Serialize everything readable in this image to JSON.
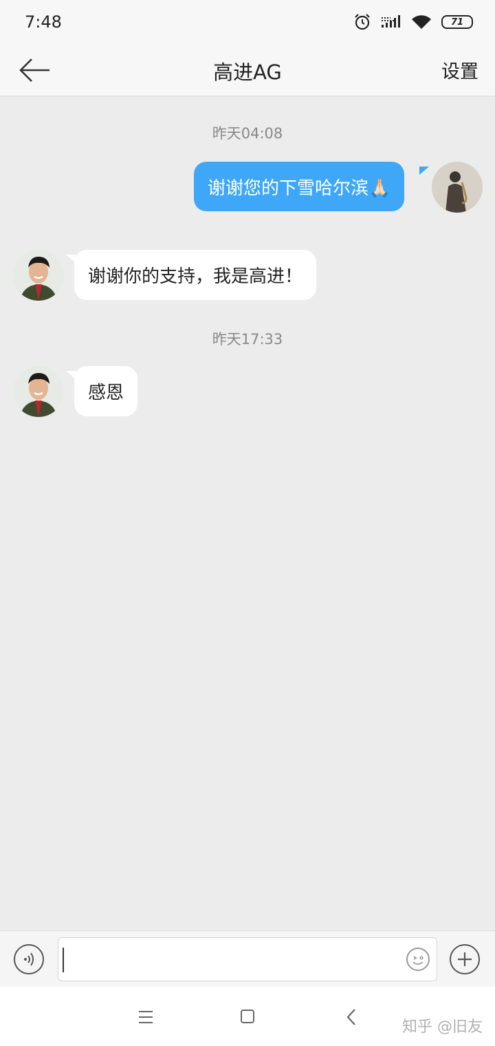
{
  "status_bar": {
    "time": "7:48",
    "battery": "71",
    "icons": [
      "alarm-icon",
      "signal-icon",
      "wifi-icon",
      "battery-icon"
    ]
  },
  "header": {
    "title": "高进AG",
    "settings_label": "设置"
  },
  "messages": [
    {
      "type": "timestamp",
      "text": "昨天04:08"
    },
    {
      "type": "sent",
      "text": "谢谢您的下雪哈尔滨🙏🏻"
    },
    {
      "type": "received",
      "text": "谢谢你的支持，我是高进！"
    },
    {
      "type": "timestamp",
      "text": "昨天17:33"
    },
    {
      "type": "received",
      "text": "感恩"
    }
  ],
  "input": {
    "value": "",
    "placeholder": ""
  },
  "watermark": "知乎 @旧友",
  "colors": {
    "sent_bubble": "#3ea7f7",
    "received_bubble": "#ffffff",
    "chat_background": "#ececec"
  }
}
